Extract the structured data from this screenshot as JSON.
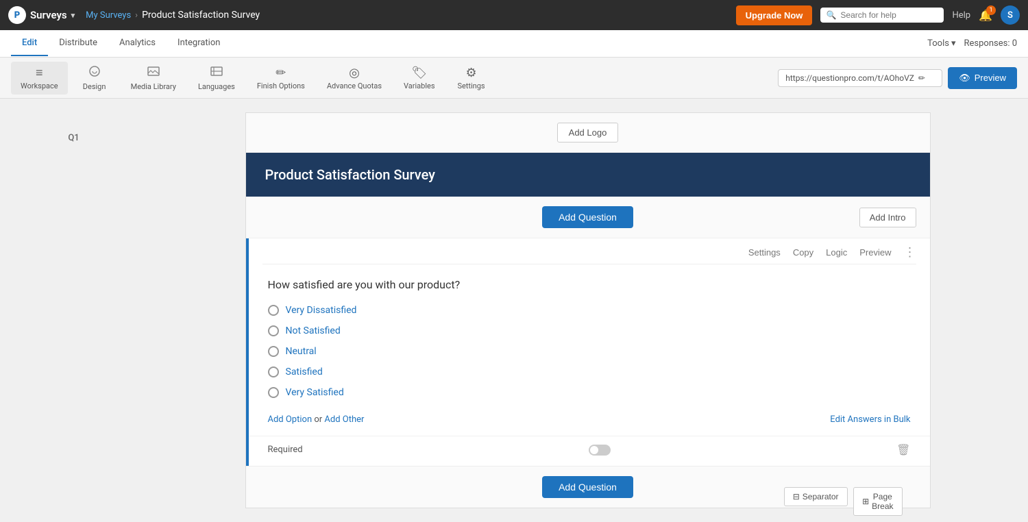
{
  "brand": {
    "logo_letter": "P",
    "name": "Surveys",
    "dropdown_icon": "▾"
  },
  "breadcrumb": {
    "home": "My Surveys",
    "separator": "›",
    "current": "Product Satisfaction Survey"
  },
  "topnav": {
    "upgrade_label": "Upgrade Now",
    "search_placeholder": "Search for help",
    "help_label": "Help",
    "notif_count": "1",
    "user_initial": "S"
  },
  "secondary_nav": {
    "tabs": [
      {
        "label": "Edit",
        "active": true
      },
      {
        "label": "Distribute",
        "active": false
      },
      {
        "label": "Analytics",
        "active": false
      },
      {
        "label": "Integration",
        "active": false
      }
    ],
    "tools_label": "Tools",
    "responses_label": "Responses: 0"
  },
  "toolbar": {
    "items": [
      {
        "icon": "≡",
        "label": "Workspace",
        "active": true
      },
      {
        "icon": "🎨",
        "label": "Design",
        "active": false
      },
      {
        "icon": "🖼",
        "label": "Media Library",
        "active": false
      },
      {
        "icon": "⌨",
        "label": "Languages",
        "active": false
      },
      {
        "icon": "✏",
        "label": "Finish Options",
        "active": false
      },
      {
        "icon": "◎",
        "label": "Advance Quotas",
        "active": false
      },
      {
        "icon": "🏷",
        "label": "Variables",
        "active": false
      },
      {
        "icon": "⚙",
        "label": "Settings",
        "active": false
      }
    ],
    "url": "https://questionpro.com/t/AOhoVZ",
    "preview_label": "Preview",
    "preview_icon": "👁"
  },
  "survey": {
    "add_logo_label": "Add Logo",
    "title": "Product Satisfaction Survey",
    "add_question_label": "Add Question",
    "add_intro_label": "Add Intro"
  },
  "question": {
    "label": "Q1",
    "text": "How satisfied are you with our product?",
    "actions": {
      "settings": "Settings",
      "copy": "Copy",
      "logic": "Logic",
      "preview": "Preview",
      "more": "⋮"
    },
    "options": [
      "Very Dissatisfied",
      "Not Satisfied",
      "Neutral",
      "Satisfied",
      "Very Satisfied"
    ],
    "add_option_label": "Add Option",
    "or_label": " or ",
    "add_other_label": "Add Other",
    "edit_bulk_label": "Edit Answers in Bulk",
    "required_label": "Required",
    "delete_icon": "🗑"
  },
  "bottom_bar": {
    "add_question_label": "Add Question",
    "page_break_icon": "⊞",
    "page_break_label": "Page Break",
    "separator_icon": "⊟",
    "separator_label": "Separator"
  }
}
